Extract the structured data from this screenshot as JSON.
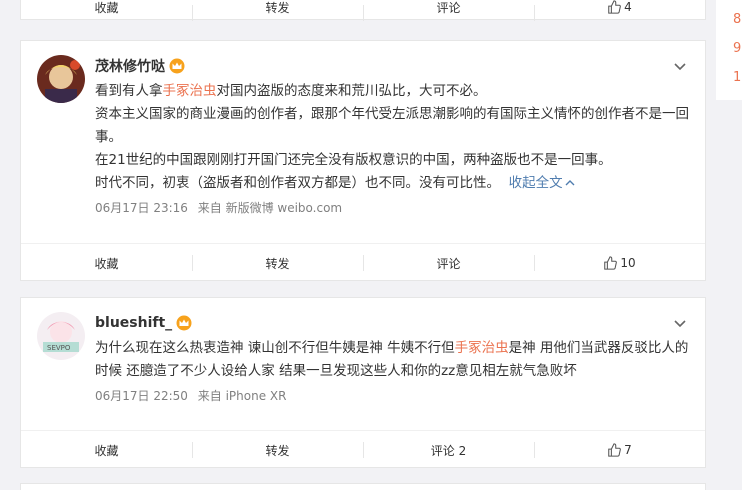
{
  "top_actions": {
    "collect": "收藏",
    "repost": "转发",
    "comment": "评论",
    "like_count": "4"
  },
  "side_numbers": [
    "8",
    "9",
    "1"
  ],
  "post1": {
    "author": "茂林修竹哒",
    "para1_before": "看到有人拿",
    "para1_topic": "手冢治虫",
    "para1_after": "对国内盗版的态度来和荒川弘比，大可不必。",
    "para2": "资本主义国家的商业漫画的创作者，跟那个年代受左派思潮影响的有国际主义情怀的创作者不是一回事。",
    "para3": "在21世纪的中国跟刚刚打开国门还完全没有版权意识的中国，两种盗版也不是一回事。",
    "para4": "时代不同，初衷（盗版者和创作者双方都是）也不同。没有可比性。",
    "collapse_label": "收起全文",
    "time": "06月17日 23:16",
    "source": "来自 新版微博 weibo.com",
    "actions": {
      "collect": "收藏",
      "repost": "转发",
      "comment": "评论",
      "like_count": "10"
    }
  },
  "post2": {
    "author": "blueshift_",
    "text_before": "为什么现在这么热衷造神 谏山创不行但牛姨是神 牛姨不行但",
    "text_topic": "手冢治虫",
    "text_after": "是神 用他们当武器反驳比人的时候 还臆造了不少人设给人家 结果一旦发现这些人和你的zz意见相左就气急败坏",
    "time": "06月17日 22:50",
    "source": "来自 iPhone XR",
    "actions": {
      "collect": "收藏",
      "repost": "转发",
      "comment": "评论 2",
      "like_count": "7"
    }
  },
  "colors": {
    "topic": "#eb7350",
    "link": "#507daf",
    "crown": "#f7a21c"
  }
}
